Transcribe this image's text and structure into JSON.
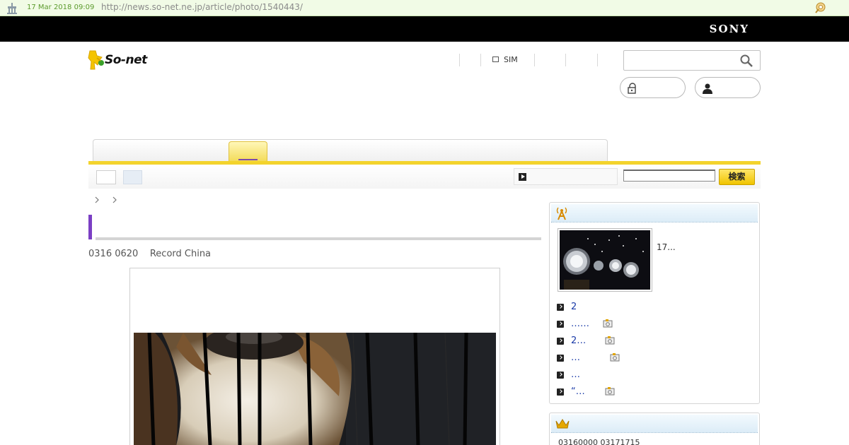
{
  "archive_bar": {
    "date": "17 Mar 2018 09:09",
    "url": "http://news.so-net.ne.jp/article/photo/1540443/",
    "logo_icon": "wayback-icon",
    "tool_icon": "archive-tool-icon"
  },
  "brand_bar": {
    "brand": "SONY"
  },
  "header": {
    "logo_text": "So-net",
    "top_nav": [
      {
        "label": ""
      },
      {
        "label": "SIM",
        "icon": "sim-icon"
      },
      {
        "label": ""
      },
      {
        "label": ""
      }
    ],
    "search": {
      "placeholder": "",
      "value": "",
      "icon": "search-icon"
    },
    "login_button": {
      "label": "",
      "icon": "lock-icon"
    },
    "member_button": {
      "label": "",
      "icon": "user-icon"
    }
  },
  "subnav": {
    "video_label": "",
    "search_value": "",
    "search_button": "検索"
  },
  "article": {
    "meta_date": "0316 0620",
    "meta_source": "Record China"
  },
  "sidebar": {
    "news_icon": "antenna-icon",
    "thumb_caption": "17...",
    "news_items": [
      {
        "text": "2",
        "camera": false
      },
      {
        "text": "……",
        "camera": true
      },
      {
        "text": "2…",
        "camera": true
      },
      {
        "text": "…",
        "camera": true
      },
      {
        "text": "…",
        "camera": false
      },
      {
        "text": "“…",
        "camera": true
      }
    ],
    "ranking_icon": "crown-icon",
    "ranking_text": "03160000  03171715"
  },
  "colors": {
    "accent_yellow": "#f3d32c",
    "title_purple": "#7b3fc4",
    "link_blue": "#1a3aa8",
    "archive_green": "#5b9a2c"
  }
}
